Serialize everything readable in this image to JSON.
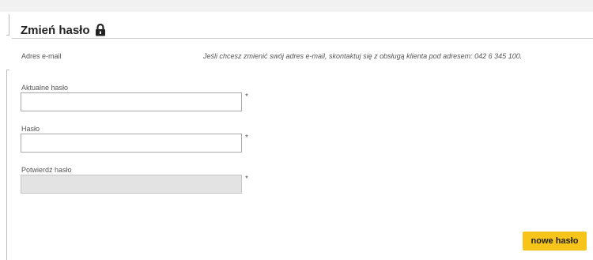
{
  "section": {
    "title": "Zmień hasło",
    "lock_icon": "lock-icon"
  },
  "email": {
    "label": "Adres e-mail",
    "note": "Jeśli chcesz zmienić swój adres e-mail, skontaktuj się z obsługą klienta pod adresem: 042 6 345 100."
  },
  "fields": {
    "current_password": {
      "label": "Aktualne hasło",
      "value": "",
      "required_mark": "*"
    },
    "new_password": {
      "label": "Hasło",
      "value": "",
      "required_mark": "*"
    },
    "confirm_password": {
      "label": "Potwierdź hasło",
      "value": "",
      "required_mark": "*",
      "disabled": true
    }
  },
  "actions": {
    "submit_label": "nowe hasło"
  },
  "colors": {
    "accent_button": "#f7c51a",
    "disabled_field": "#e3e3e3",
    "top_band": "#f1f1f1"
  }
}
